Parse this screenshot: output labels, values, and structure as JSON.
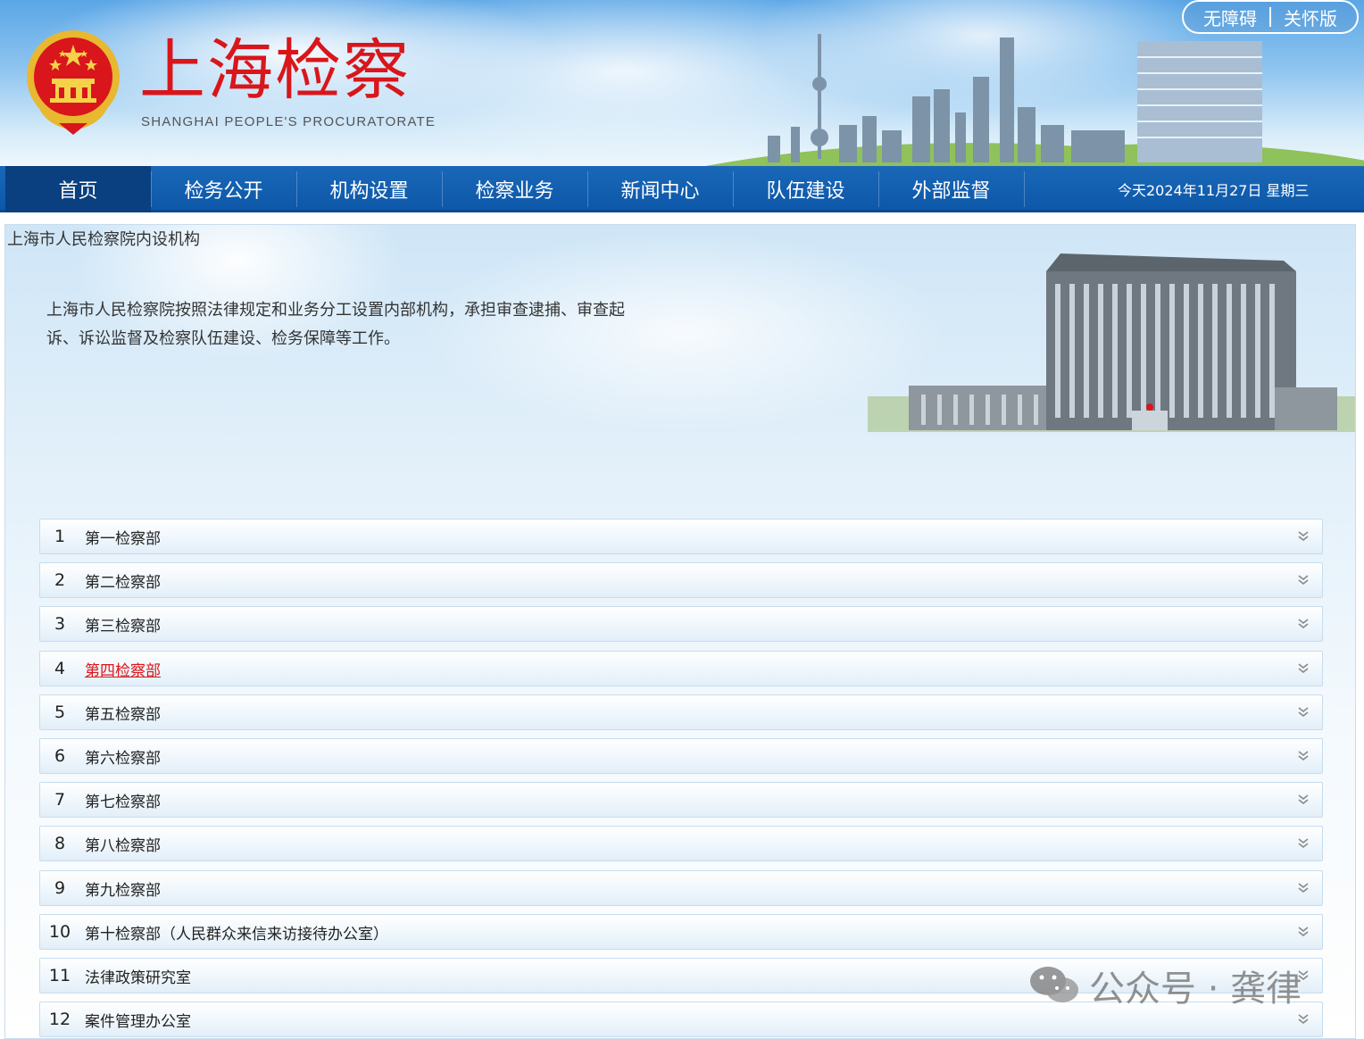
{
  "header": {
    "logo_cn": "上海检察",
    "logo_en": "SHANGHAI PEOPLE'S PROCURATORATE",
    "accessibility_label": "无障碍",
    "care_mode_label": "关怀版",
    "emblem_icon": "national-emblem-icon"
  },
  "nav": {
    "items": [
      {
        "label": "首页",
        "active": true
      },
      {
        "label": "检务公开"
      },
      {
        "label": "机构设置"
      },
      {
        "label": "检察业务"
      },
      {
        "label": "新闻中心"
      },
      {
        "label": "队伍建设"
      },
      {
        "label": "外部监督"
      }
    ],
    "date": "今天2024年11月27日 星期三"
  },
  "panel": {
    "title": "上海市人民检察院内设机构",
    "intro": "上海市人民检察院按照法律规定和业务分工设置内部机构，承担审查逮捕、审查起诉、诉讼监督及检察队伍建设、检务保障等工作。"
  },
  "departments": [
    {
      "num": "1",
      "name": "第一检察部"
    },
    {
      "num": "2",
      "name": "第二检察部"
    },
    {
      "num": "3",
      "name": "第三检察部"
    },
    {
      "num": "4",
      "name": "第四检察部",
      "highlighted": true
    },
    {
      "num": "5",
      "name": "第五检察部"
    },
    {
      "num": "6",
      "name": "第六检察部"
    },
    {
      "num": "7",
      "name": "第七检察部"
    },
    {
      "num": "8",
      "name": "第八检察部"
    },
    {
      "num": "9",
      "name": "第九检察部"
    },
    {
      "num": "10",
      "name": "第十检察部（人民群众来信来访接待办公室）"
    },
    {
      "num": "11",
      "name": "法律政策研究室"
    },
    {
      "num": "12",
      "name": "案件管理办公室"
    }
  ],
  "watermark": {
    "text": "公众号 · 龚律",
    "icon": "wechat-icon"
  },
  "colors": {
    "brand_red": "#d8161b",
    "nav_blue": "#0d58a8",
    "nav_active": "#0a3f80"
  }
}
